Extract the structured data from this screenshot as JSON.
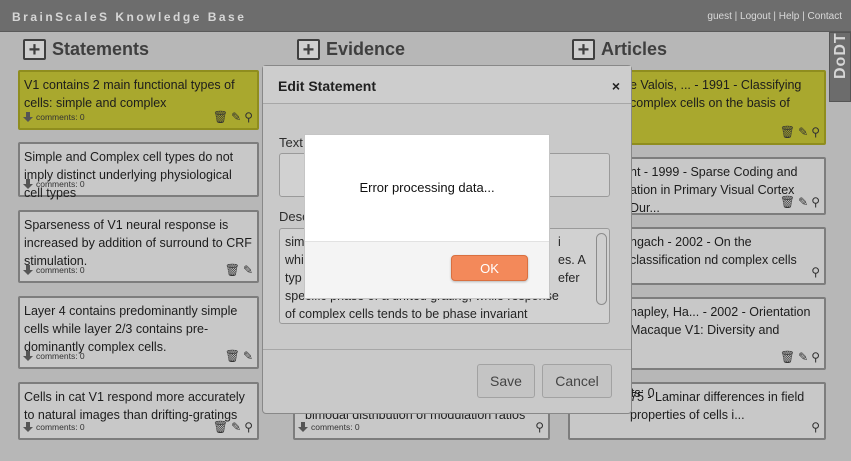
{
  "app": {
    "brand": "BrainScaleS Knowledge Base",
    "links": [
      "guest",
      "Logout",
      "Help",
      "Contact"
    ],
    "side_tab": "DoDT"
  },
  "columns": {
    "statements": "Statements",
    "evidence": "Evidence",
    "articles": "Articles"
  },
  "statements": [
    {
      "text": "V1 contains 2 main functional types of cells: simple and complex",
      "comments": "comments: 0",
      "highlighted": true
    },
    {
      "text": "Simple and Complex cell types do not imply distinct underlying physiological cell types",
      "comments": "comments: 0",
      "highlighted": false
    },
    {
      "text": "Sparseness of V1 neural response is increased by addition of surround to CRF stimulation.",
      "comments": "comments: 0",
      "highlighted": false
    },
    {
      "text": "Layer 4 contains predominantly simple cells while layer 2/3 contains pre-dominantly complex cells.",
      "comments": "comments: 0",
      "highlighted": false
    },
    {
      "text": "Cells in cat V1 respond more accurately to natural images than drifting-gratings",
      "comments": "comments: 0",
      "highlighted": false
    }
  ],
  "evidence": [
    {
      "text": "bimodal distribution of modulation ratios",
      "comments": "comments: 0"
    }
  ],
  "articles": [
    {
      "text": "e Valois, ... - 1991 - Classifying complex cells on the basis of",
      "comments": "",
      "highlighted": true
    },
    {
      "text": "nt - 1999 - Sparse Coding and ation in Primary Visual Cortex Dur...",
      "comments": "",
      "highlighted": false
    },
    {
      "text": "ngach - 2002 - On the classification nd complex cells",
      "comments": "",
      "highlighted": false
    },
    {
      "text": "hapley, Ha... - 2002 - Orientation Macaque V1: Diversity and",
      "comments": "",
      "highlighted": false
    },
    {
      "text": "75 - Laminar differences in field properties of cells i...",
      "comments": "comments: 0",
      "highlighted": false
    }
  ],
  "dialog": {
    "title": "Edit Statement",
    "close": "×",
    "text_label": "Text",
    "description_label": "Desc",
    "description_lines": [
      "sim",
      "whi",
      "typ",
      "specific phase of a drifted grating, while response",
      "of complex cells tends to be phase invariant"
    ],
    "description_right_fragments": [
      "i",
      "es. A",
      "efer"
    ],
    "save_label": "Save",
    "cancel_label": "Cancel"
  },
  "alert": {
    "message": "Error processing data...",
    "ok_label": "OK"
  }
}
